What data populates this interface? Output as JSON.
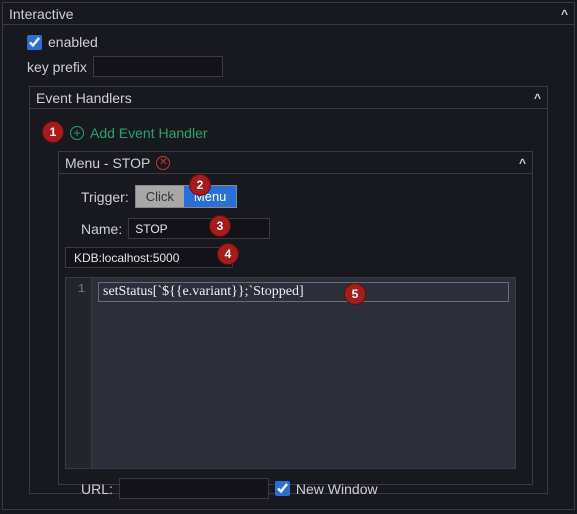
{
  "root": {
    "title": "Interactive",
    "enabled_label": "enabled",
    "enabled_value": true,
    "key_prefix_label": "key prefix",
    "key_prefix_value": ""
  },
  "handlers": {
    "title": "Event Handlers",
    "add_label": "Add Event Handler"
  },
  "handler": {
    "title": "Menu - STOP",
    "trigger_label": "Trigger:",
    "trigger_options": {
      "click": "Click",
      "menu": "Menu"
    },
    "name_label": "Name:",
    "name_value": "STOP",
    "datasource": "KDB:localhost:5000",
    "code_line_no": "1",
    "code": "setStatus[`${{e.variant}};`Stopped]",
    "url_label": "URL:",
    "url_value": "",
    "new_window_label": "New Window",
    "new_window_value": true
  },
  "annotations": {
    "b1": "1",
    "b2": "2",
    "b3": "3",
    "b4": "4",
    "b5": "5"
  }
}
